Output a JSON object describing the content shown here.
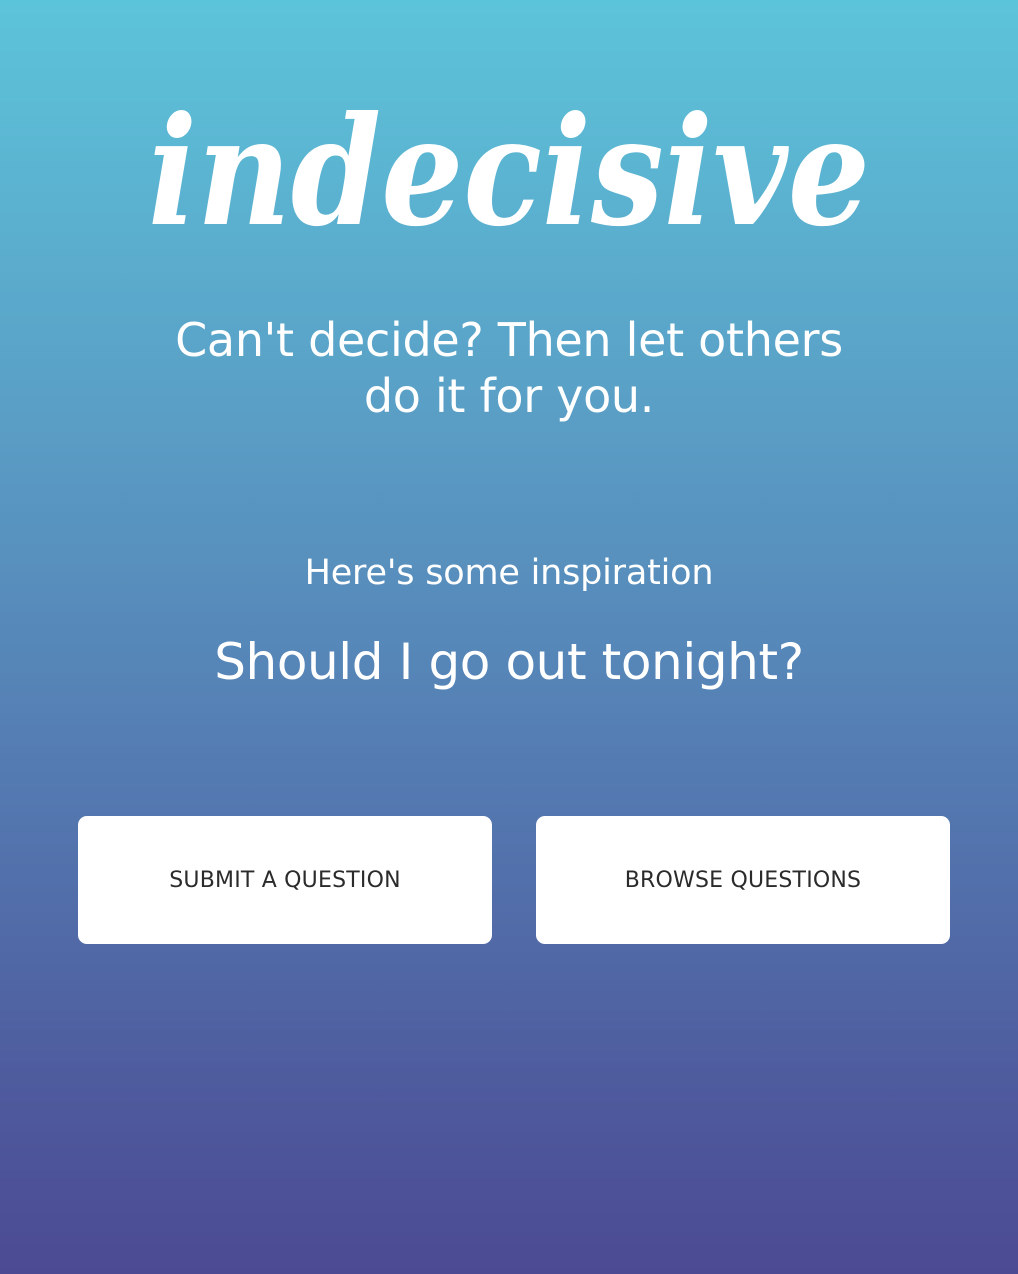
{
  "app": {
    "logo_text": "indecisive"
  },
  "hero": {
    "tagline": "Can't decide? Then let others do it for you."
  },
  "inspiration": {
    "label": "Here's some inspiration",
    "question": "Should I go out tonight?"
  },
  "actions": {
    "submit_label": "SUBMIT A QUESTION",
    "browse_label": "BROWSE QUESTIONS"
  },
  "colors": {
    "background_top": "#5cc4da",
    "background_bottom": "#4c4a93",
    "button_background": "#ffffff",
    "button_text": "#2b2b2b",
    "text": "#ffffff"
  }
}
